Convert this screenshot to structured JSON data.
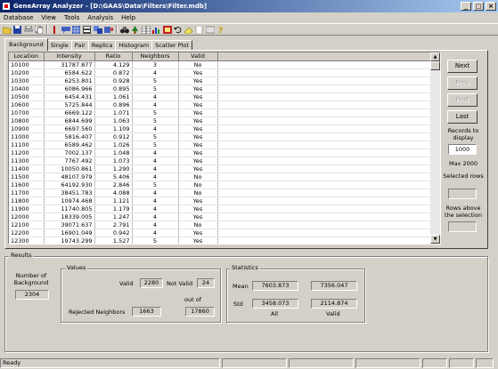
{
  "window": {
    "title": "GeneArray Analyzer - [D:\\GAAS\\Data\\Filters\\Filter.mdb]"
  },
  "menu": [
    "Database",
    "View",
    "Tools",
    "Analysis",
    "Help"
  ],
  "toolbar": {
    "icons": [
      "open-icon",
      "save-icon",
      "print-icon",
      "copy-icon",
      "flag-icon",
      "chat-icon",
      "grid-icon",
      "stack-icon",
      "copy-layers-icon",
      "export-icon",
      "binoculars-icon",
      "tree-icon",
      "table-icon",
      "chart-icon",
      "image-icon",
      "undo-icon",
      "eraser-icon",
      "help-icon"
    ]
  },
  "tabs": [
    "Background",
    "Single",
    "Pair",
    "Replica",
    "Histogram",
    "Scatter Plot"
  ],
  "grid": {
    "columns": [
      "Location",
      "Intensity",
      "Ratio",
      "Neighbors",
      "Valid"
    ],
    "rows": [
      [
        "10100",
        "31787.877",
        "4.129",
        "3",
        "No"
      ],
      [
        "10200",
        "6584.622",
        "0.872",
        "4",
        "Yes"
      ],
      [
        "10300",
        "6253.801",
        "0.928",
        "5",
        "Yes"
      ],
      [
        "10400",
        "6086.966",
        "0.895",
        "5",
        "Yes"
      ],
      [
        "10500",
        "6454.431",
        "1.061",
        "4",
        "Yes"
      ],
      [
        "10600",
        "5725.844",
        "0.896",
        "4",
        "Yes"
      ],
      [
        "10700",
        "6669.122",
        "1.071",
        "5",
        "Yes"
      ],
      [
        "10800",
        "6844.699",
        "1.063",
        "5",
        "Yes"
      ],
      [
        "10900",
        "6697.560",
        "1.109",
        "4",
        "Yes"
      ],
      [
        "11000",
        "5816.407",
        "0.912",
        "5",
        "Yes"
      ],
      [
        "11100",
        "6589.462",
        "1.026",
        "5",
        "Yes"
      ],
      [
        "11200",
        "7002.137",
        "1.048",
        "4",
        "Yes"
      ],
      [
        "11300",
        "7767.492",
        "1.073",
        "4",
        "Yes"
      ],
      [
        "11400",
        "10050.861",
        "1.290",
        "4",
        "Yes"
      ],
      [
        "11500",
        "48107.979",
        "5.406",
        "4",
        "No"
      ],
      [
        "11600",
        "64192.930",
        "2.846",
        "5",
        "No"
      ],
      [
        "11700",
        "38451.783",
        "4.088",
        "4",
        "No"
      ],
      [
        "11800",
        "10974.468",
        "1.121",
        "4",
        "Yes"
      ],
      [
        "11900",
        "11740.805",
        "1.179",
        "4",
        "Yes"
      ],
      [
        "12000",
        "18339.005",
        "1.247",
        "4",
        "Yes"
      ],
      [
        "12100",
        "39071.637",
        "2.791",
        "4",
        "No"
      ],
      [
        "12200",
        "16901.049",
        "0.942",
        "4",
        "Yes"
      ],
      [
        "12300",
        "19743.299",
        "1.527",
        "5",
        "Yes"
      ],
      [
        "12400",
        "12694.266",
        "1.176",
        "4",
        "Yes"
      ]
    ]
  },
  "nav": {
    "next": "Next",
    "prev": "Prev",
    "first": "First",
    "last": "Last"
  },
  "records": {
    "label": "Records to display",
    "value": "1000",
    "max": "Max 2000",
    "selected_label": "Selected rows",
    "selected_value": "",
    "rows_above_label": "Rows above the selection",
    "rows_above_value": ""
  },
  "results": {
    "label": "Results",
    "background_label": "Number of Background",
    "background_value": "2304",
    "values": {
      "label": "Values",
      "valid_label": "Valid",
      "valid_value": "2280",
      "not_valid_label": "Not Valid",
      "not_valid_value": "24",
      "out_of_label": "out of",
      "rejected_label": "Rejected Neighbors",
      "rejected_value": "1663",
      "out_of_value": "17860"
    },
    "statistics": {
      "label": "Statistics",
      "mean_label": "Mean",
      "mean_all": "7603.873",
      "mean_valid": "7356.047",
      "std_label": "Std",
      "std_all": "3458.073",
      "std_valid": "2114.874",
      "all_label": "All",
      "valid_label": "Valid"
    }
  },
  "status": {
    "text": "Ready"
  }
}
